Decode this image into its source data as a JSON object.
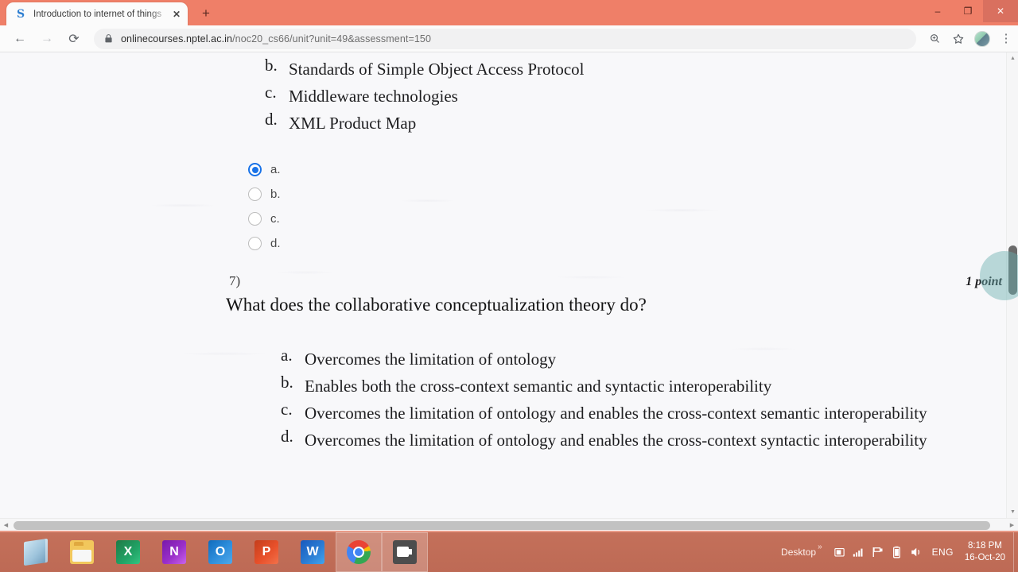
{
  "browser": {
    "tab": {
      "favicon": "swayam-s-icon",
      "title": "Introduction to internet of things",
      "close_label": "✕"
    },
    "new_tab_label": "+",
    "window_controls": {
      "minimize": "–",
      "maximize": "❐",
      "close": "✕"
    },
    "toolbar": {
      "back": "←",
      "forward": "→",
      "reload": "⟳",
      "url_domain": "onlinecourses.nptel.ac.in",
      "url_path": "/noc20_cs66/unit?unit=49&assessment=150",
      "zoom_icon": "zoom-in-icon",
      "bookmark_icon": "☆",
      "profile_icon": "profile-avatar",
      "menu_icon": "⋮"
    }
  },
  "page": {
    "question6": {
      "options": [
        {
          "letter": "b.",
          "text": "Standards of Simple Object Access Protocol"
        },
        {
          "letter": "c.",
          "text": "Middleware technologies"
        },
        {
          "letter": "d.",
          "text": "XML Product Map"
        }
      ],
      "radios": [
        {
          "label": "a.",
          "checked": true
        },
        {
          "label": "b.",
          "checked": false
        },
        {
          "label": "c.",
          "checked": false
        },
        {
          "label": "d.",
          "checked": false
        }
      ]
    },
    "question7": {
      "number": "7)",
      "points": "1 point",
      "text": "What does the collaborative conceptualization theory do?",
      "options": [
        {
          "letter": "a.",
          "text": "Overcomes the limitation of ontology"
        },
        {
          "letter": "b.",
          "text": "Enables both the cross-context semantic and syntactic interoperability"
        },
        {
          "letter": "c.",
          "text": "Overcomes the limitation of ontology and enables the cross-context semantic interoperability"
        },
        {
          "letter": "d.",
          "text": "Overcomes the limitation of ontology and enables the cross-context syntactic interoperability"
        }
      ]
    },
    "scrollbars": {
      "v_up": "▲",
      "v_down": "▼",
      "h_left": "◀",
      "h_right": "▶"
    }
  },
  "taskbar": {
    "apps": [
      {
        "name": "store-app",
        "label": ""
      },
      {
        "name": "file-explorer",
        "label": ""
      },
      {
        "name": "excel",
        "label": "X"
      },
      {
        "name": "onenote",
        "label": "N"
      },
      {
        "name": "outlook",
        "label": "O"
      },
      {
        "name": "powerpoint",
        "label": "P"
      },
      {
        "name": "word",
        "label": "W"
      },
      {
        "name": "chrome",
        "label": ""
      },
      {
        "name": "screen-recorder",
        "label": ""
      }
    ],
    "desktop_label": "Desktop",
    "overflow_label": "»",
    "language": "ENG",
    "time": "8:18 PM",
    "date": "16-Oct-20"
  }
}
